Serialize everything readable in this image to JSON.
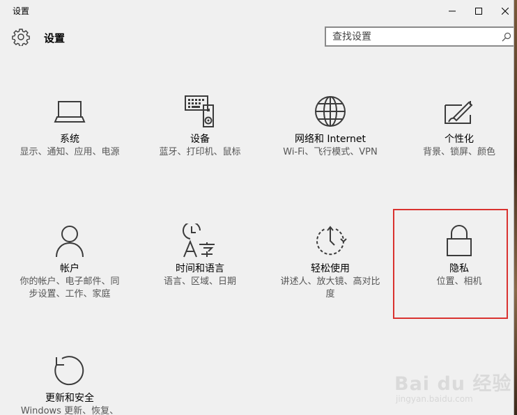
{
  "window": {
    "title": "设置",
    "minimize_label": "Minimize",
    "maximize_label": "Maximize",
    "close_label": "Close"
  },
  "header": {
    "title": "设置",
    "icon": "gear-icon"
  },
  "search": {
    "placeholder": "查找设置",
    "icon": "search-icon"
  },
  "tiles": [
    {
      "title": "系统",
      "description": "显示、通知、应用、电源",
      "icon": "laptop-icon"
    },
    {
      "title": "设备",
      "description": "蓝牙、打印机、鼠标",
      "icon": "devices-icon"
    },
    {
      "title": "网络和 Internet",
      "description": "Wi-Fi、飞行模式、VPN",
      "icon": "globe-icon"
    },
    {
      "title": "个性化",
      "description": "背景、锁屏、颜色",
      "icon": "personalization-icon"
    },
    {
      "title": "帐户",
      "description": "你的帐户、电子邮件、同步设置、工作、家庭",
      "icon": "person-icon"
    },
    {
      "title": "时间和语言",
      "description": "语言、区域、日期",
      "icon": "time-language-icon"
    },
    {
      "title": "轻松使用",
      "description": "讲述人、放大镜、高对比度",
      "icon": "ease-of-access-icon"
    },
    {
      "title": "隐私",
      "description": "位置、相机",
      "icon": "lock-icon"
    },
    {
      "title": "更新和安全",
      "description": "Windows 更新、恢复、备份",
      "icon": "update-icon"
    }
  ],
  "highlight": {
    "target": "隐私",
    "color": "#d9322f"
  },
  "watermark": {
    "main": "Bai du 经验",
    "sub": "jingyan.baidu.com"
  },
  "colors": {
    "window_bg": "#f0f0f0",
    "icon_stroke": "#3b3b3b",
    "description": "#555555"
  }
}
